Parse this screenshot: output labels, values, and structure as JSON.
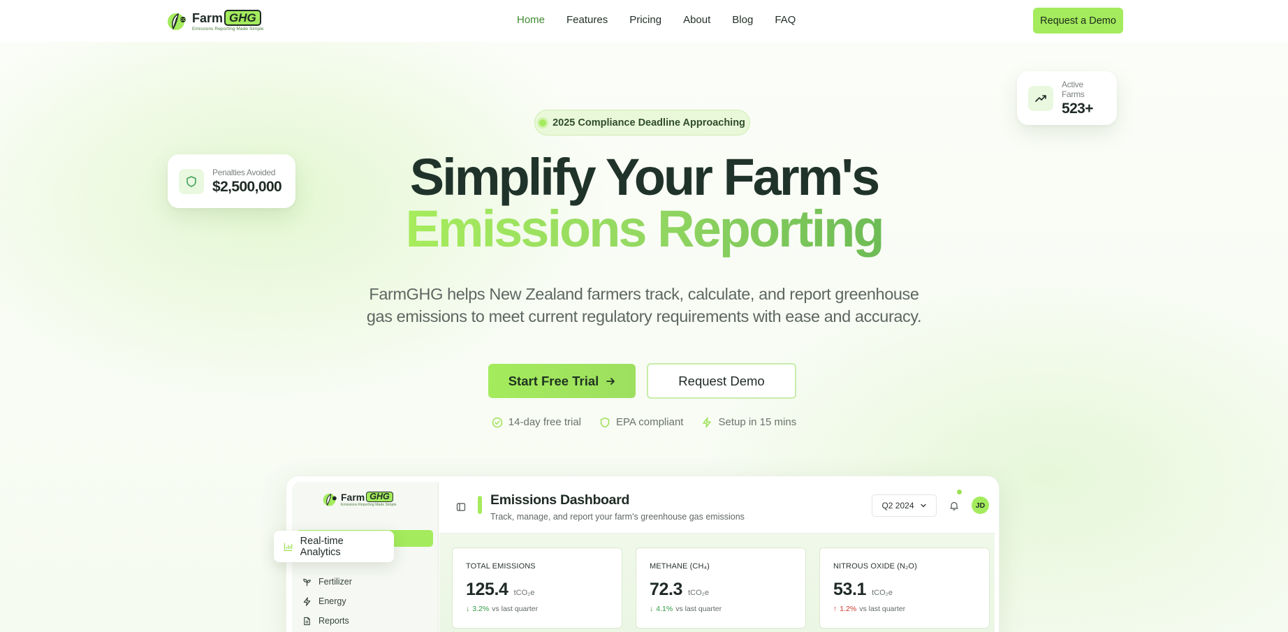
{
  "brand": {
    "name_part1": "Farm",
    "name_part2": "GHG",
    "tagline": "Emissions Reporting Made Simple"
  },
  "nav": {
    "links": [
      "Home",
      "Features",
      "Pricing",
      "About",
      "Blog",
      "FAQ"
    ],
    "active": "Home",
    "cta": "Request a Demo"
  },
  "hero": {
    "badge": "2025 Compliance Deadline Approaching",
    "headline_line1": "Simplify Your Farm's",
    "headline_line2": "Emissions Reporting",
    "subtitle": "FarmGHG helps New Zealand farmers track, calculate, and report greenhouse gas emissions to meet current regulatory requirements with ease and accuracy.",
    "primary_cta": "Start Free Trial",
    "secondary_cta": "Request Demo",
    "features": [
      "14-day free trial",
      "EPA compliant",
      "Setup in 15 mins"
    ]
  },
  "floating_cards": {
    "penalties": {
      "label": "Penalties Avoided",
      "value": "$2,500,000"
    },
    "farms": {
      "label": "Active Farms",
      "value": "523+"
    }
  },
  "dashboard": {
    "title": "Emissions Dashboard",
    "subtitle": "Track, manage, and report your farm's greenhouse gas emissions",
    "period": "Q2 2024",
    "avatar_initials": "JD",
    "analytics_pill": "Real-time Analytics",
    "sidebar_items": [
      "Fertilizer",
      "Energy",
      "Reports"
    ],
    "metrics": [
      {
        "label": "TOTAL EMISSIONS",
        "value": "125.4",
        "unit": "tCO₂e",
        "change": "3.2%",
        "direction": "down",
        "compare": "vs last quarter"
      },
      {
        "label": "METHANE (CH₄)",
        "value": "72.3",
        "unit": "tCO₂e",
        "change": "4.1%",
        "direction": "down",
        "compare": "vs last quarter"
      },
      {
        "label": "NITROUS OXIDE (N₂O)",
        "value": "53.1",
        "unit": "tCO₂e",
        "change": "1.2%",
        "direction": "up",
        "compare": "vs last quarter"
      }
    ]
  },
  "colors": {
    "accent": "#a4eb5d",
    "heading": "#20332b",
    "positive": "#2f9b45",
    "negative": "#d0372c"
  }
}
